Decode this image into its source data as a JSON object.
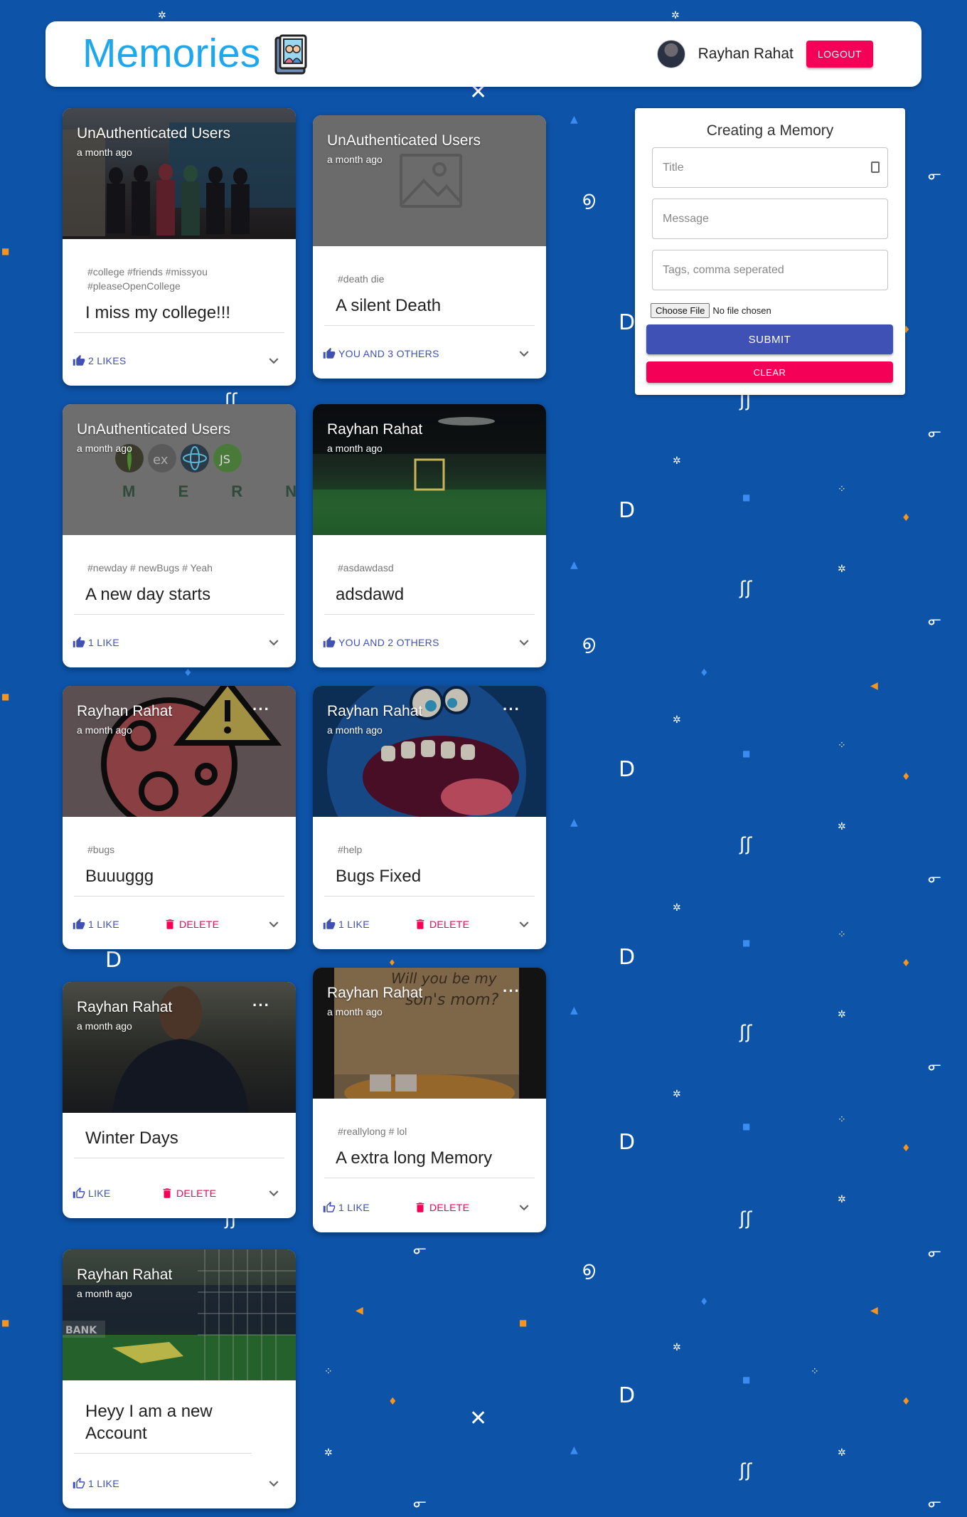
{
  "header": {
    "title": "Memories",
    "user_name": "Rayhan Rahat",
    "logout_label": "LOGOUT"
  },
  "posts": [
    {
      "author": "UnAuthenticated Users",
      "time": "a month ago",
      "tags": "#college #friends #missyou #pleaseOpenCollege",
      "title": "I miss my college!!!",
      "likes": "2 LIKES"
    },
    {
      "author": "UnAuthenticated Users",
      "time": "a month ago",
      "tags": "#death die",
      "title": "A silent Death",
      "likes": "YOU AND 3 OTHERS"
    },
    {
      "author": "UnAuthenticated Users",
      "time": "a month ago",
      "tags": "#newday # newBugs # Yeah",
      "title": "A new day starts",
      "likes": "1 LIKE",
      "media_text": "M E R N"
    },
    {
      "author": "Rayhan Rahat",
      "time": "a month ago",
      "tags": "#asdawdasd",
      "title": "adsdawd",
      "likes": "YOU AND 2 OTHERS"
    },
    {
      "author": "Rayhan Rahat",
      "time": "a month ago",
      "tags": "#bugs",
      "title": "Buuuggg",
      "likes": "1 LIKE",
      "delete": "DELETE"
    },
    {
      "author": "Rayhan Rahat",
      "time": "a month ago",
      "tags": "#help",
      "title": "Bugs Fixed",
      "likes": "1 LIKE",
      "delete": "DELETE"
    },
    {
      "author": "Rayhan Rahat",
      "time": "a month ago",
      "tags": "",
      "title": "Winter Days",
      "likes": "LIKE",
      "delete": "DELETE"
    },
    {
      "author": "Rayhan Rahat",
      "time": "a month ago",
      "tags": "#reallylong # lol",
      "title": "A extra long Memory",
      "likes": "1 LIKE",
      "delete": "DELETE"
    },
    {
      "author": "Rayhan Rahat",
      "time": "a month ago",
      "tags": "",
      "title": "Heyy I am a new Account",
      "likes": "1 LIKE"
    }
  ],
  "form": {
    "heading": "Creating a Memory",
    "title_placeholder": "Title",
    "message_placeholder": "Message",
    "tags_placeholder": "Tags, comma seperated",
    "file_button": "Choose File",
    "file_status": "No file chosen",
    "submit_label": "SUBMIT",
    "clear_label": "CLEAR"
  },
  "colors": {
    "background": "#0d53a8",
    "brand": "#1ea7ec",
    "primary": "#3f51b5",
    "secondary": "#f50057"
  }
}
